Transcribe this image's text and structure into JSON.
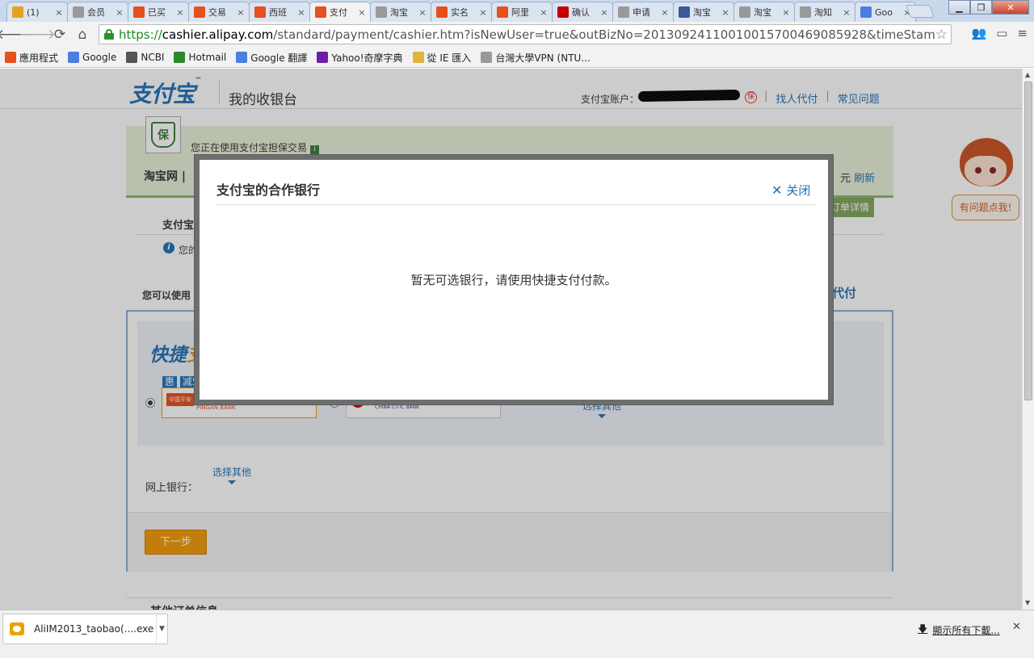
{
  "browser": {
    "tabs": [
      {
        "title": "(1)",
        "icon": "google-drive-icon",
        "color": "#e5a21d"
      },
      {
        "title": "会员",
        "icon": "page-icon",
        "color": "#999999"
      },
      {
        "title": "已买",
        "icon": "taobao-icon",
        "color": "#e5501c"
      },
      {
        "title": "交易",
        "icon": "taobao-icon",
        "color": "#e5501c"
      },
      {
        "title": "西班",
        "icon": "taobao-icon",
        "color": "#e5501c"
      },
      {
        "title": "支付",
        "icon": "alipay-icon",
        "color": "#e5501c",
        "active": true
      },
      {
        "title": "淘宝",
        "icon": "page-icon",
        "color": "#999999"
      },
      {
        "title": "实名",
        "icon": "alipay-icon",
        "color": "#e5501c"
      },
      {
        "title": "阿里",
        "icon": "taobao-icon",
        "color": "#e5501c"
      },
      {
        "title": "确认",
        "icon": "tmall-icon",
        "color": "#c40000"
      },
      {
        "title": "申请",
        "icon": "page-icon",
        "color": "#999999"
      },
      {
        "title": "淘宝",
        "icon": "facebook-icon",
        "color": "#3b5998"
      },
      {
        "title": "淘宝",
        "icon": "page-icon",
        "color": "#999999"
      },
      {
        "title": "淘知",
        "icon": "page-icon",
        "color": "#999999"
      },
      {
        "title": "Goo",
        "icon": "google-icon",
        "color": "#4a7fe0"
      }
    ],
    "url_scheme": "https://",
    "url_host": "cashier.alipay.com",
    "url_rest": "/standard/payment/cashier.htm?isNewUser=true&outBizNo=20130924110010015700469085928&timeStam",
    "bookmarks": [
      {
        "label": "應用程式",
        "icon": "apps-grid-icon"
      },
      {
        "label": "Google",
        "icon": "google-icon"
      },
      {
        "label": "NCBI",
        "icon": "ncbi-icon"
      },
      {
        "label": "Hotmail",
        "icon": "windows-icon"
      },
      {
        "label": "Google 翻譯",
        "icon": "google-translate-icon"
      },
      {
        "label": "Yahoo!奇摩字典",
        "icon": "yahoo-icon"
      },
      {
        "label": "從 IE 匯入",
        "icon": "folder-icon"
      },
      {
        "label": "台灣大學VPN (NTU...",
        "icon": "page-icon"
      }
    ]
  },
  "page": {
    "logo_text": "支付宝",
    "logo_tm": "™",
    "header_title": "我的收银台",
    "account_label": "支付宝账户：",
    "bao_char": "保",
    "header_links": [
      "找人代付",
      "常见问题"
    ],
    "guarantee_badge": "保",
    "guarantee_text": "您正在使用支付宝担保交易",
    "guarantee_info": "i",
    "seller": "淘宝网 |",
    "amount_suffix": "元",
    "refresh_label": "刷新",
    "order_detail": "订单详情",
    "pay_label": "支付宝",
    "info_text": "您的",
    "can_use": "您可以使用",
    "daifu": "代付",
    "quick_title_a": "快捷",
    "quick_title_b": "支",
    "promo_hui": "惠",
    "promo_text": "减5",
    "bank1_logo": "中国平安",
    "bank1_en": "PINGAN BANK",
    "bank2_en": "CHINA CITIC BANK",
    "quick_select_other": "选择其他",
    "net_bank_label": "网上银行：",
    "net_select_other": "选择其他",
    "next_button": "下一步",
    "more_title": "其他订单信息"
  },
  "mascot": {
    "bubble": "有问题点我!"
  },
  "modal": {
    "title": "支付宝的合作银行",
    "close_label": "关闭",
    "message": "暂无可选银行，请使用快捷支付付款。"
  },
  "downloads": {
    "file_name": "AliIM2013_taobao(....exe",
    "show_all": "顯示所有下載..."
  }
}
